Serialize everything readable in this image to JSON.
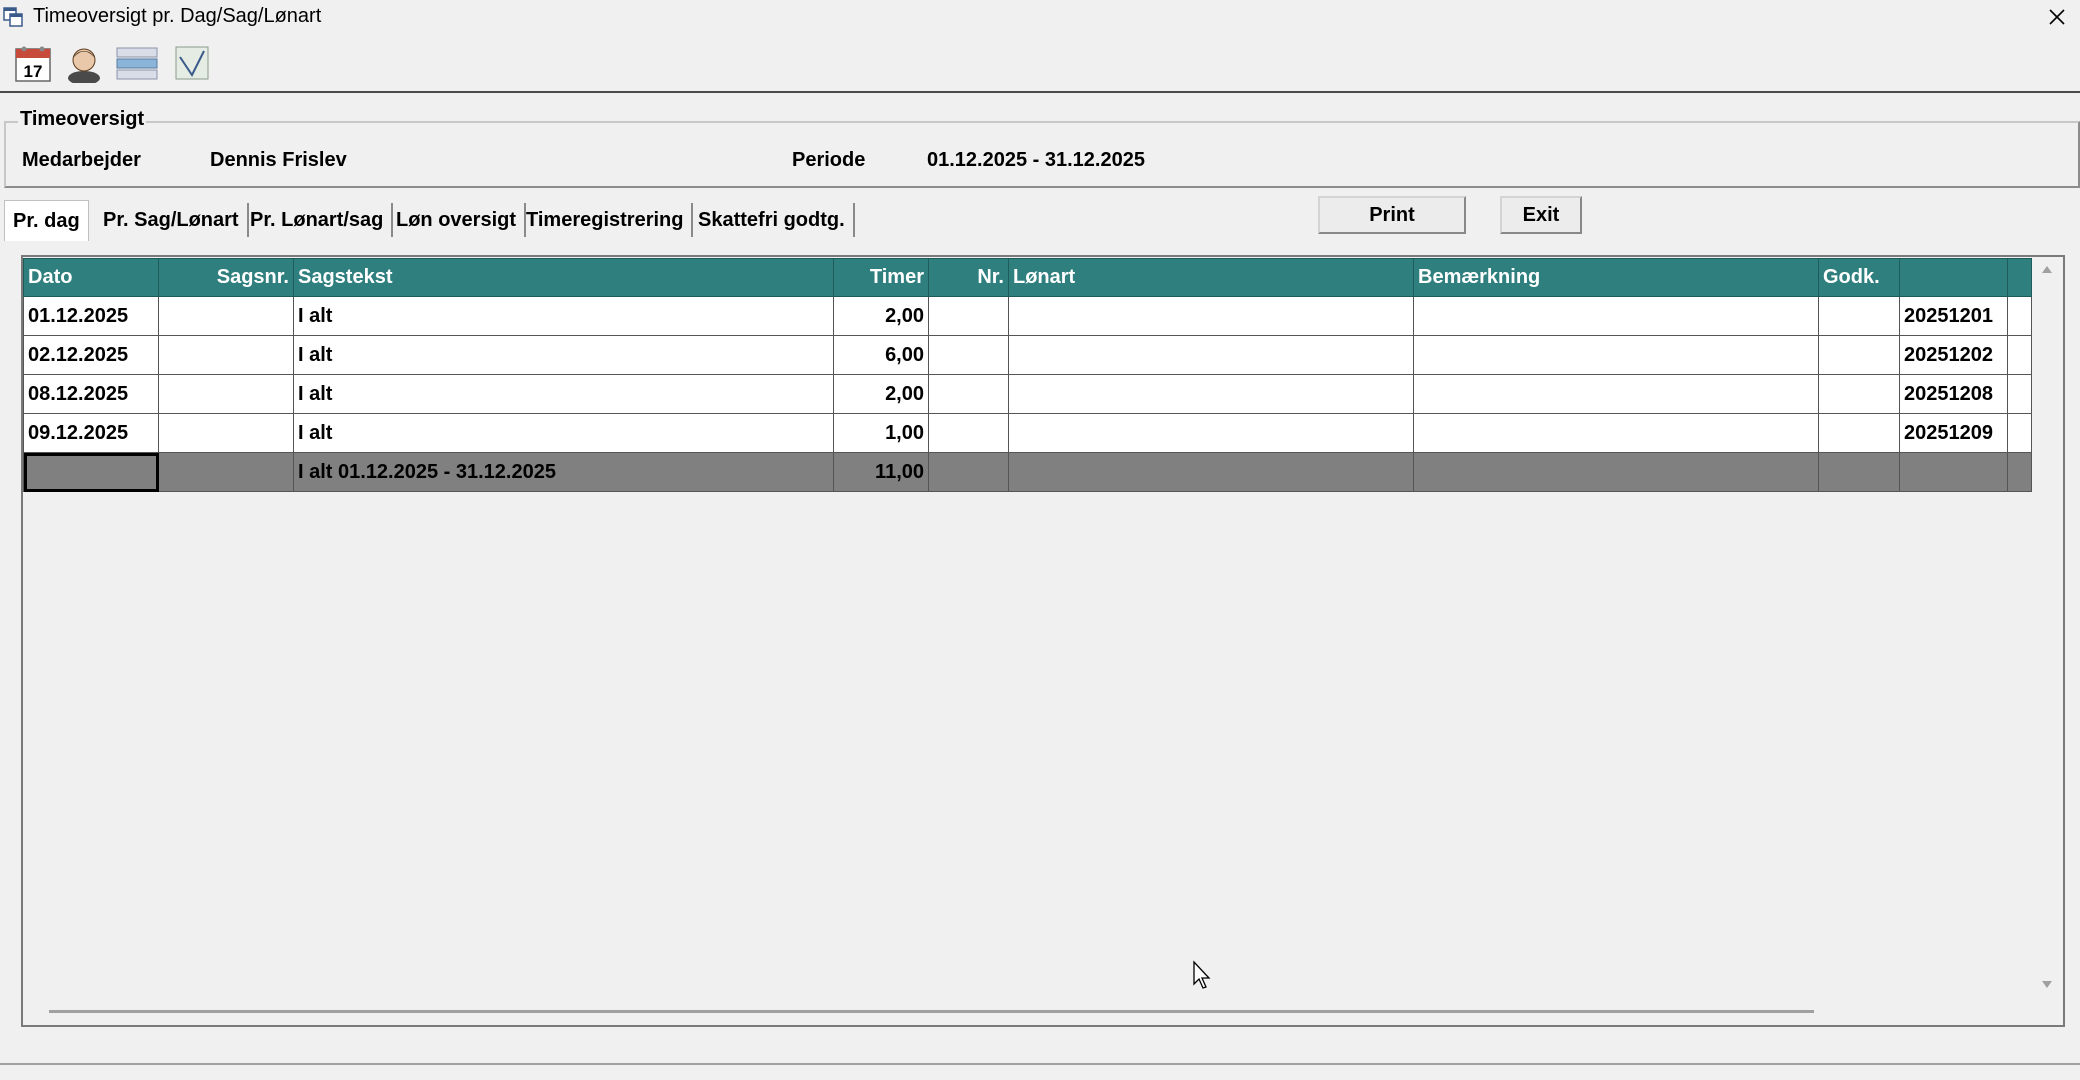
{
  "window": {
    "title": "Timeoversigt pr. Dag/Sag/Lønart"
  },
  "toolbar": {
    "calendar_day": "17"
  },
  "header": {
    "group_title": "Timeoversigt",
    "employee_label": "Medarbejder",
    "employee_value": "Dennis Frislev",
    "period_label": "Periode",
    "period_value": "01.12.2025 - 31.12.2025"
  },
  "tabs": [
    {
      "label": "Pr. dag",
      "active": true
    },
    {
      "label": "Pr. Sag/Lønart"
    },
    {
      "label": "Pr. Lønart/sag"
    },
    {
      "label": "Løn oversigt"
    },
    {
      "label": "Timeregistrering"
    },
    {
      "label": "Skattefri godtg."
    }
  ],
  "buttons": {
    "print": "Print",
    "exit": "Exit"
  },
  "grid": {
    "columns": [
      "Dato",
      "Sagsnr.",
      "Sagstekst",
      "Timer",
      "Nr.",
      "Lønart",
      "Bemærkning",
      "Godk.",
      "",
      ""
    ],
    "rows": [
      {
        "dato": "01.12.2025",
        "sagsnr": "",
        "sagstekst": "I alt",
        "timer": "2,00",
        "nr": "",
        "lonart": "",
        "bemaerkning": "",
        "godk": "",
        "key": "20251201"
      },
      {
        "dato": "02.12.2025",
        "sagsnr": "",
        "sagstekst": "I alt",
        "timer": "6,00",
        "nr": "",
        "lonart": "",
        "bemaerkning": "",
        "godk": "",
        "key": "20251202"
      },
      {
        "dato": "08.12.2025",
        "sagsnr": "",
        "sagstekst": "I alt",
        "timer": "2,00",
        "nr": "",
        "lonart": "",
        "bemaerkning": "",
        "godk": "",
        "key": "20251208"
      },
      {
        "dato": "09.12.2025",
        "sagsnr": "",
        "sagstekst": "I alt",
        "timer": "1,00",
        "nr": "",
        "lonart": "",
        "bemaerkning": "",
        "godk": "",
        "key": "20251209"
      }
    ],
    "total": {
      "sagstekst": "I alt  01.12.2025 - 31.12.2025",
      "timer": "11,00"
    }
  },
  "colors": {
    "header_bg": "#2f7f7f",
    "total_bg": "#808080"
  }
}
